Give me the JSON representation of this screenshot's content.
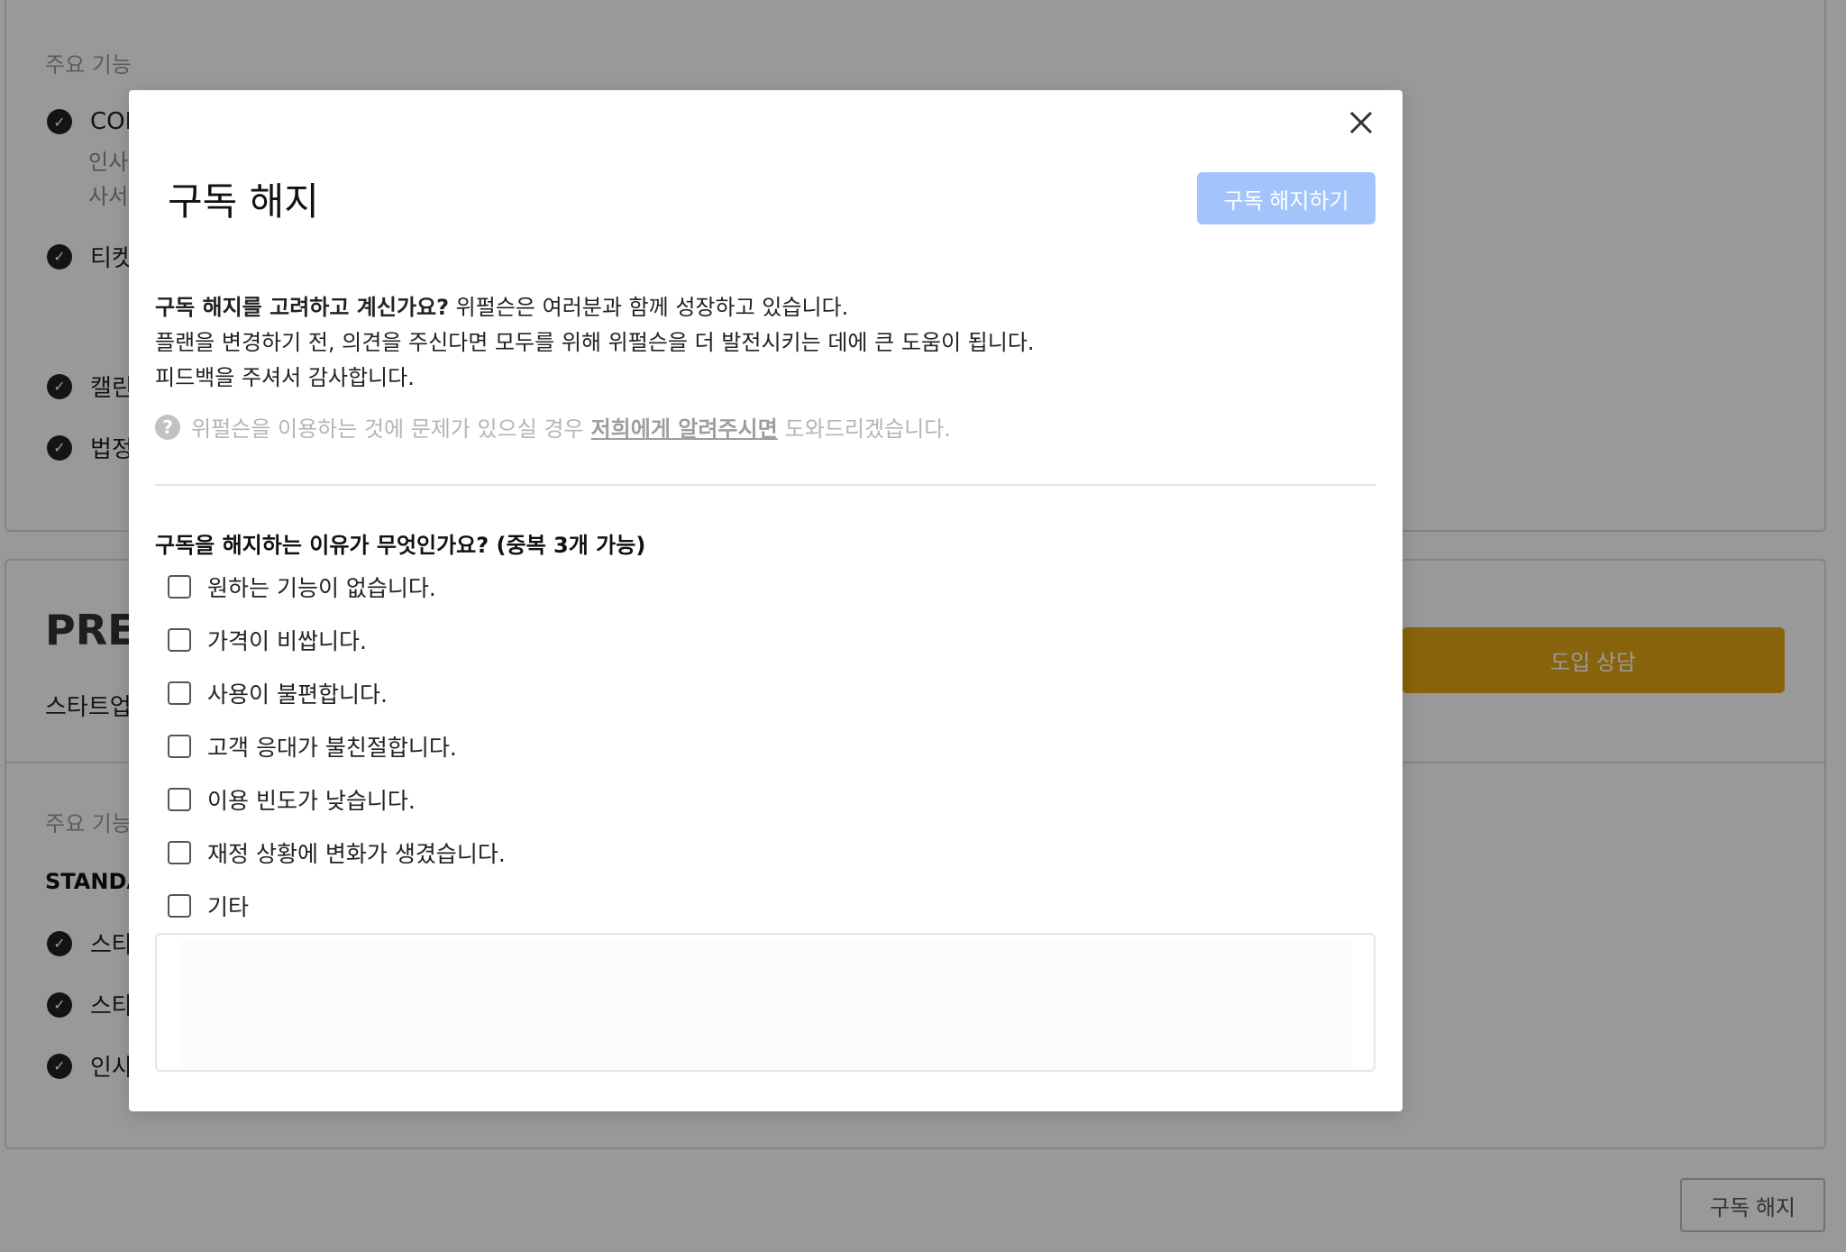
{
  "background": {
    "features_label_top": "주요 기능",
    "top_items": [
      {
        "label": "COR",
        "sub1": "인사",
        "sub2": "사서"
      },
      {
        "label": "티켓"
      },
      {
        "label": "캘린"
      },
      {
        "label": "법정"
      }
    ],
    "plan_title": "PRE",
    "plan_desc": "스타트업",
    "consult_button": "도입 상담",
    "features_label_bottom": "주요 기능",
    "standard_label": "STANDA",
    "bottom_items": [
      "스타",
      "스타",
      "인사"
    ],
    "unsubscribe_button": "구독 해지"
  },
  "modal": {
    "title": "구독 해지",
    "unsubscribe_button": "구독 해지하기",
    "intro_bold": "구독 해지를 고려하고 계신가요?",
    "intro_line1": " 위펄슨은 여러분과 함께 성장하고 있습니다.",
    "intro_line2": "플랜을 변경하기 전, 의견을 주신다면 모두를 위해 위펄슨을 더 발전시키는 데에 큰 도움이 됩니다.",
    "intro_line3": "피드백을 주셔서 감사합니다.",
    "help_prefix": "위펄슨을 이용하는 것에 문제가 있으실 경우",
    "help_link": "저희에게 알려주시면",
    "help_suffix": "도와드리겠습니다.",
    "question": "구독을 해지하는 이유가 무엇인가요? (중복 3개 가능)",
    "reasons": [
      "원하는 기능이 없습니다.",
      "가격이 비쌉니다.",
      "사용이 불편합니다.",
      "고객 응대가 불친절합니다.",
      "이용 빈도가 낮습니다.",
      "재정 상황에 변화가 생겼습니다.",
      "기타"
    ],
    "other_text": ""
  },
  "colors": {
    "accent_disabled": "#a3c4fb",
    "consult": "#e3a514",
    "overlay": "rgba(0,0,0,0.4)"
  }
}
